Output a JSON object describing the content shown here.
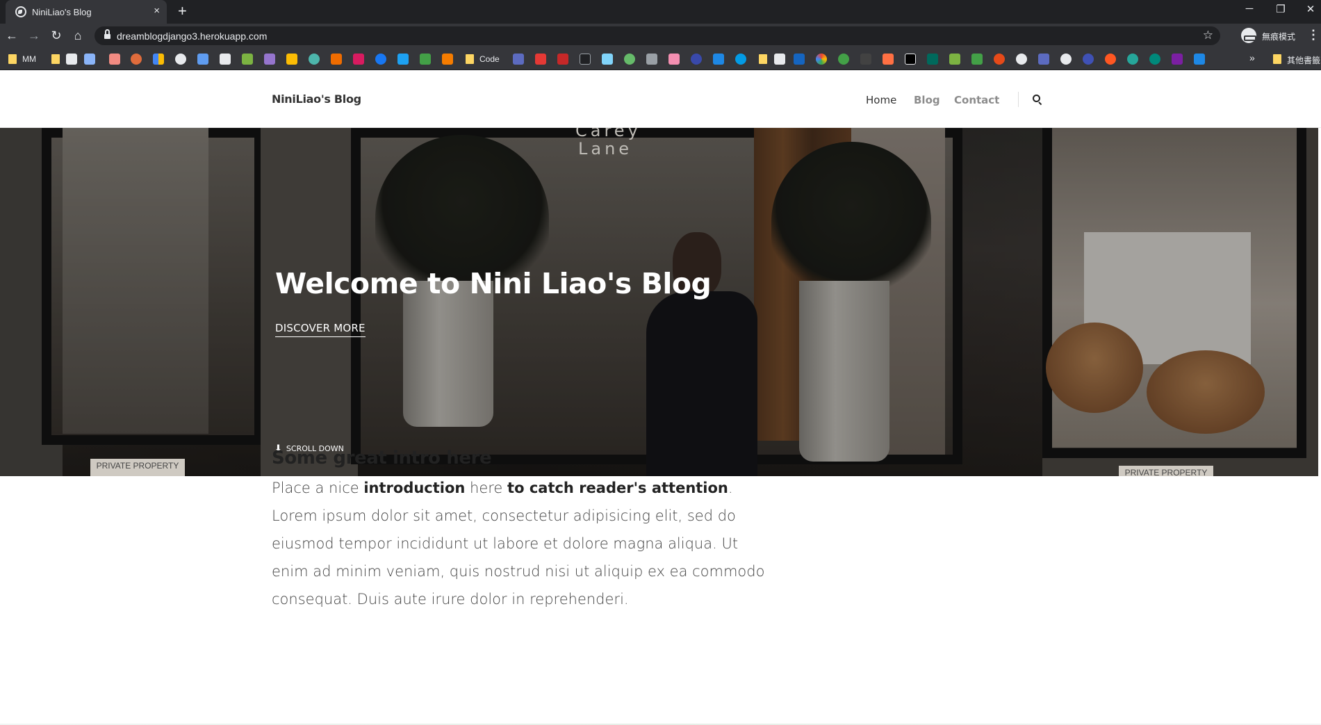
{
  "browser": {
    "tab_title": "NiniLiao's Blog",
    "tab_close": "×",
    "new_tab": "+",
    "url": "dreamblogdjango3.herokuapp.com",
    "profile_label": "無痕模式",
    "window_controls": [
      "─",
      "❐",
      "✕"
    ],
    "nav_buttons": [
      "←",
      "→",
      "↻",
      "⌂"
    ],
    "star": "☆",
    "menu": "⋮",
    "bookmarks": {
      "mm_label": "MM",
      "code_label": "Code",
      "more_chevron": "»",
      "other_label": "其他書籤"
    }
  },
  "site": {
    "brand": "NiniLiao's Blog",
    "nav": [
      {
        "label": "Home"
      },
      {
        "label": "Blog"
      },
      {
        "label": "Contact"
      }
    ],
    "hero": {
      "title": "Welcome to Nini Liao's Blog",
      "cta": "DISCOVER MORE",
      "scroll_label": "SCROLL DOWN",
      "scroll_arrow": "⬇",
      "sign_line1": "Carey",
      "sign_line2": "Lane",
      "plaque_left": "PRIVATE PROPERTY",
      "plaque_right": "PRIVATE PROPERTY"
    },
    "intro": {
      "heading": "Some great intro here",
      "p_start": "Place a nice ",
      "p_bold1": "introduction",
      "p_mid": " here ",
      "p_bold2": "to catch reader's attention",
      "p_rest": ". Lorem ipsum dolor sit amet, consectetur adipisicing elit, sed do eiusmod tempor incididunt ut labore et dolore magna aliqua. Ut enim ad minim veniam, quis nostrud nisi ut aliquip ex ea commodo consequat. Duis aute irure dolor in reprehenderi."
    }
  }
}
